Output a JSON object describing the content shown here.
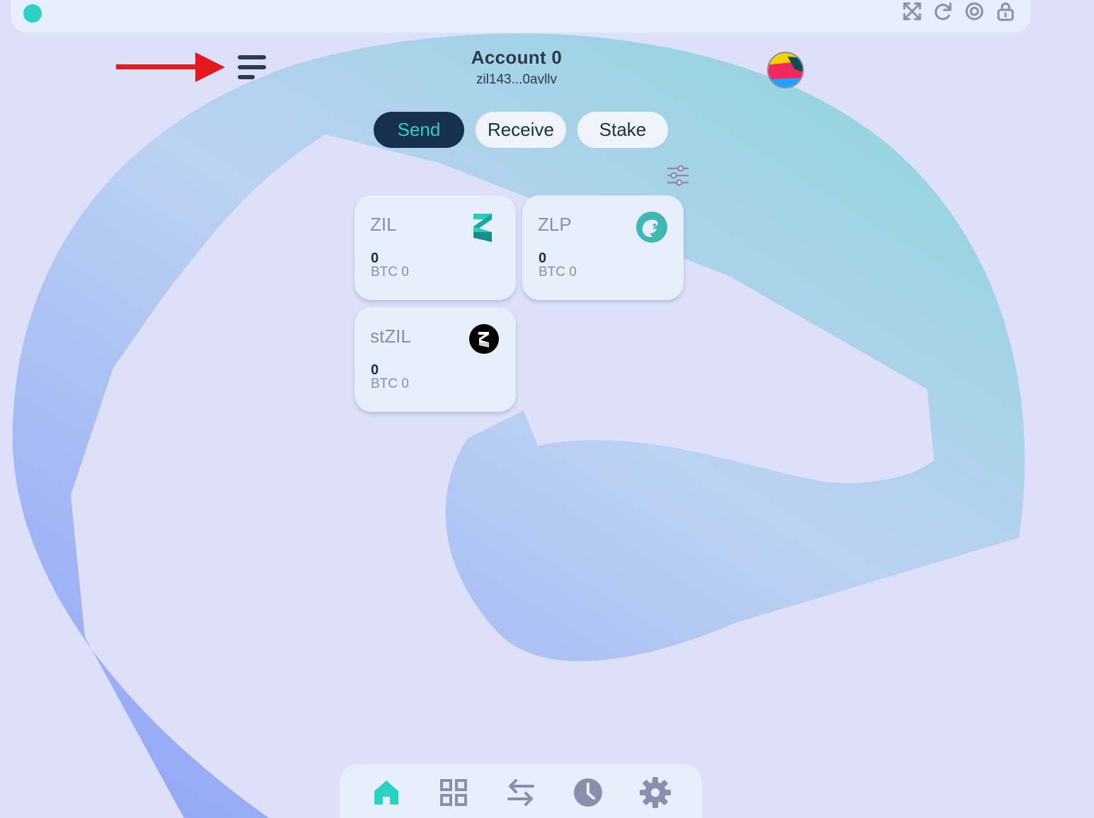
{
  "theme": {
    "accent": "#2cd1c5",
    "dark": "#16304d",
    "muted": "#8b8fad",
    "card": "#e7eefc",
    "arrow": "#e3191c"
  },
  "topbar": {
    "status_color": "#2cd1c5",
    "icons": [
      "expand-icon",
      "refresh-icon",
      "target-icon",
      "lock-icon"
    ]
  },
  "header": {
    "menu_icon": "hamburger-menu-icon",
    "account_name": "Account 0",
    "account_address": "zil143...0avllv"
  },
  "actions": {
    "send": "Send",
    "receive": "Receive",
    "stake": "Stake"
  },
  "tokens": [
    {
      "symbol": "ZIL",
      "amount": "0",
      "btc": "BTC 0",
      "icon": "zilliqa-logo-icon"
    },
    {
      "symbol": "ZLP",
      "amount": "0",
      "btc": "BTC 0",
      "icon": "zlp-dragon-icon"
    },
    {
      "symbol": "stZIL",
      "amount": "0",
      "btc": "BTC 0",
      "icon": "stzil-logo-icon"
    }
  ],
  "bottom_nav": [
    "home-icon",
    "grid-icon",
    "swap-icon",
    "history-icon",
    "settings-icon"
  ]
}
